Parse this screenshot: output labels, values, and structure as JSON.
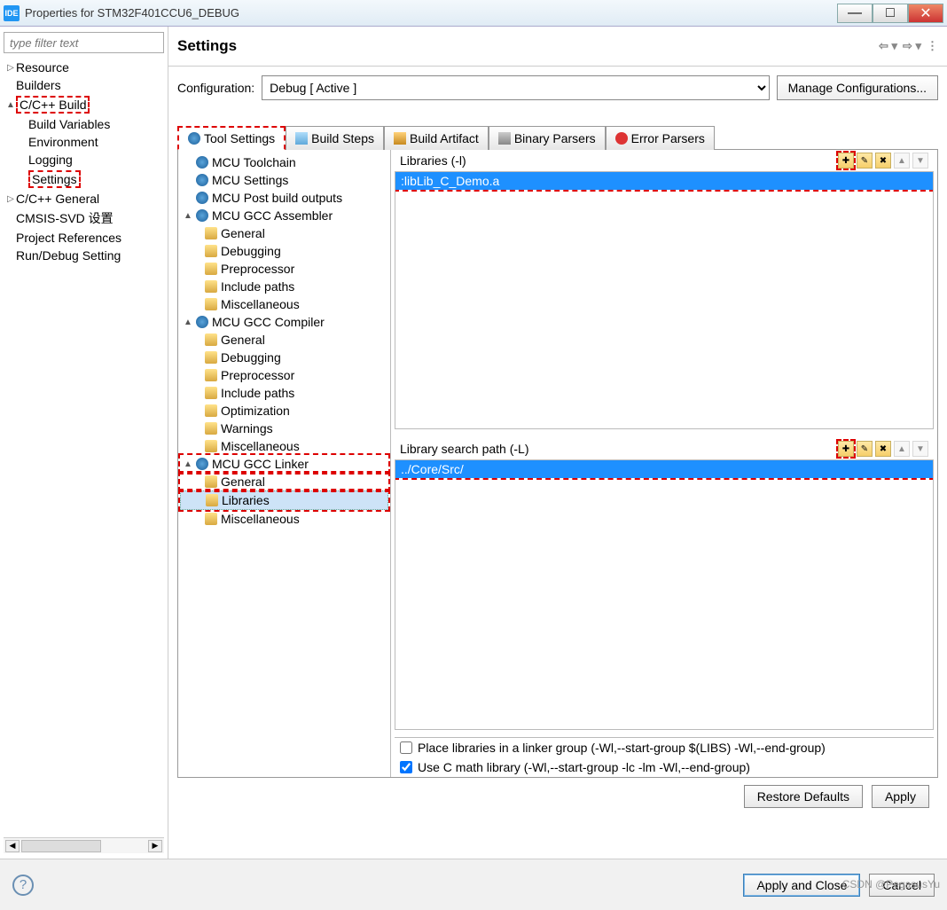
{
  "window": {
    "app_icon_label": "IDE",
    "title": "Properties for STM32F401CCU6_DEBUG"
  },
  "filter_placeholder": "type filter text",
  "nav": [
    {
      "label": "Resource",
      "indent": 0,
      "exp": "▷"
    },
    {
      "label": "Builders",
      "indent": 0,
      "exp": ""
    },
    {
      "label": "C/C++ Build",
      "indent": 0,
      "exp": "▲",
      "highlight": true
    },
    {
      "label": "Build Variables",
      "indent": 1,
      "exp": ""
    },
    {
      "label": "Environment",
      "indent": 1,
      "exp": ""
    },
    {
      "label": "Logging",
      "indent": 1,
      "exp": ""
    },
    {
      "label": "Settings",
      "indent": 1,
      "exp": "",
      "highlight": true
    },
    {
      "label": "C/C++ General",
      "indent": 0,
      "exp": "▷"
    },
    {
      "label": "CMSIS-SVD 设置",
      "indent": 0,
      "exp": ""
    },
    {
      "label": "Project References",
      "indent": 0,
      "exp": ""
    },
    {
      "label": "Run/Debug Setting",
      "indent": 0,
      "exp": ""
    }
  ],
  "right": {
    "title": "Settings",
    "config_label": "Configuration:",
    "config_value": "Debug  [ Active ]",
    "manage_btn": "Manage Configurations...",
    "tabs": [
      {
        "label": "Tool Settings",
        "icon": "ic-gear",
        "active": true,
        "highlight": true
      },
      {
        "label": "Build Steps",
        "icon": "ic-tool"
      },
      {
        "label": "Build Artifact",
        "icon": "ic-hammer"
      },
      {
        "label": "Binary Parsers",
        "icon": "ic-bin"
      },
      {
        "label": "Error Parsers",
        "icon": "ic-err"
      }
    ],
    "tool_tree": [
      {
        "label": "MCU Toolchain",
        "lvl": 0,
        "icon": "ic-gear"
      },
      {
        "label": "MCU Settings",
        "lvl": 0,
        "icon": "ic-gear"
      },
      {
        "label": "MCU Post build outputs",
        "lvl": 0,
        "icon": "ic-gear"
      },
      {
        "label": "MCU GCC Assembler",
        "lvl": 0,
        "exp": "▲",
        "icon": "ic-gear"
      },
      {
        "label": "General",
        "lvl": 1,
        "icon": "ic-fold"
      },
      {
        "label": "Debugging",
        "lvl": 1,
        "icon": "ic-fold"
      },
      {
        "label": "Preprocessor",
        "lvl": 1,
        "icon": "ic-fold"
      },
      {
        "label": "Include paths",
        "lvl": 1,
        "icon": "ic-fold"
      },
      {
        "label": "Miscellaneous",
        "lvl": 1,
        "icon": "ic-fold"
      },
      {
        "label": "MCU GCC Compiler",
        "lvl": 0,
        "exp": "▲",
        "icon": "ic-gear"
      },
      {
        "label": "General",
        "lvl": 1,
        "icon": "ic-fold"
      },
      {
        "label": "Debugging",
        "lvl": 1,
        "icon": "ic-fold"
      },
      {
        "label": "Preprocessor",
        "lvl": 1,
        "icon": "ic-fold"
      },
      {
        "label": "Include paths",
        "lvl": 1,
        "icon": "ic-fold"
      },
      {
        "label": "Optimization",
        "lvl": 1,
        "icon": "ic-fold"
      },
      {
        "label": "Warnings",
        "lvl": 1,
        "icon": "ic-fold"
      },
      {
        "label": "Miscellaneous",
        "lvl": 1,
        "icon": "ic-fold"
      },
      {
        "label": "MCU GCC Linker",
        "lvl": 0,
        "exp": "▲",
        "icon": "ic-gear",
        "highlight": true
      },
      {
        "label": "General",
        "lvl": 1,
        "icon": "ic-fold",
        "highlight": true
      },
      {
        "label": "Libraries",
        "lvl": 1,
        "icon": "ic-fold",
        "selected": true,
        "highlight": true
      },
      {
        "label": "Miscellaneous",
        "lvl": 1,
        "icon": "ic-fold"
      }
    ],
    "libs_header": "Libraries (-l)",
    "libs_items": [
      ":libLib_C_Demo.a"
    ],
    "libpath_header": "Library search path (-L)",
    "libpath_items": [
      "../Core/Src/"
    ],
    "check1": "Place libraries in a linker group (-Wl,--start-group $(LIBS) -Wl,--end-group)",
    "check2": "Use C math library (-Wl,--start-group -lc -lm -Wl,--end-group)",
    "check1_on": false,
    "check2_on": true,
    "restore_btn": "Restore Defaults",
    "apply_btn": "Apply"
  },
  "footer": {
    "apply_close": "Apply and Close",
    "cancel": "Cancel"
  },
  "watermark": "CSDN @PegasusYu"
}
